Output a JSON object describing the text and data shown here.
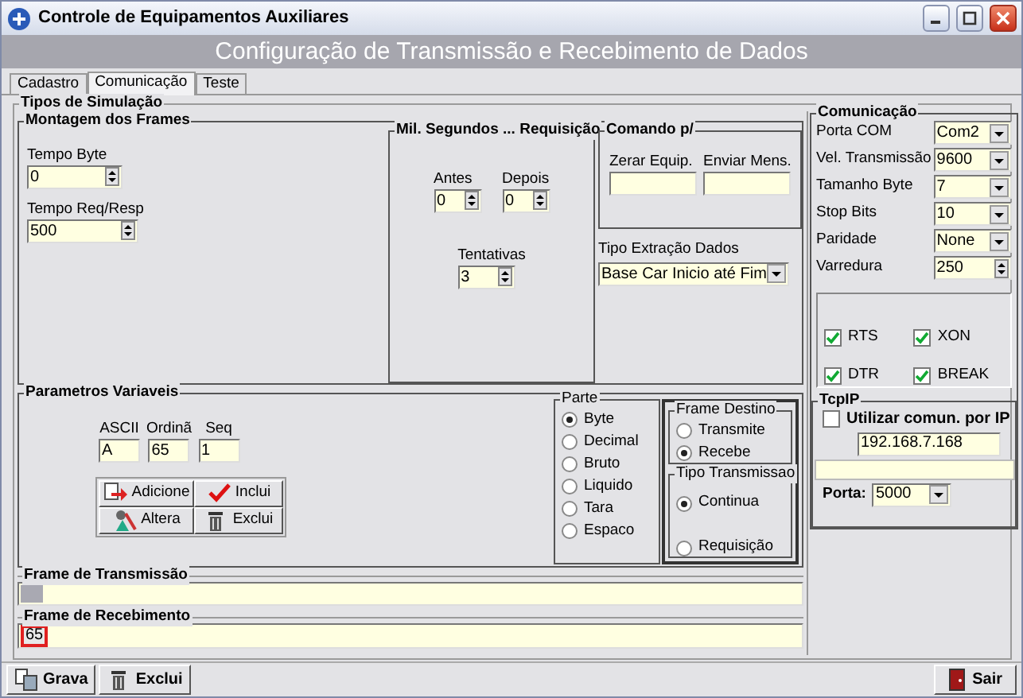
{
  "window": {
    "title": "Controle de Equipamentos Auxiliares"
  },
  "header": "Configuração de Transmissão e Recebimento de Dados",
  "tabs": [
    {
      "label": "Cadastro",
      "selected": false
    },
    {
      "label": "Comunicação",
      "selected": true
    },
    {
      "label": "Teste",
      "selected": false
    }
  ],
  "simulation": {
    "title": "Tipos de Simulação",
    "frame_assembly": {
      "title": "Montagem dos Frames",
      "fields": [
        {
          "label": "Tempo Byte",
          "value": "0"
        },
        {
          "label": "Tempo Req/Resp",
          "value": "500"
        }
      ]
    },
    "request_ms": {
      "title": "Mil. Segundos ... Requisição",
      "fields": [
        {
          "label": "Antes",
          "value": "0"
        },
        {
          "label": "Depois",
          "value": "0"
        },
        {
          "label": "Tentativas",
          "value": "3"
        }
      ]
    },
    "command": {
      "title": "Comando p/",
      "fields": [
        {
          "label": "Zerar Equip."
        },
        {
          "label": "Enviar Mens."
        }
      ]
    },
    "extraction": {
      "label": "Tipo Extração Dados",
      "value": "Base Car Inicio até Fim"
    },
    "variables": {
      "title": "Parametros Variaveis",
      "fields": [
        {
          "label": "ASCII",
          "value": "A"
        },
        {
          "label": "Ordinã",
          "value": "65"
        },
        {
          "label": "Seq",
          "value": "1"
        }
      ],
      "buttons": [
        {
          "label": "Adicione"
        },
        {
          "label": "Inclui"
        },
        {
          "label": "Altera"
        },
        {
          "label": "Exclui"
        }
      ]
    },
    "part": {
      "title": "Parte",
      "options": [
        {
          "label": "Byte",
          "selected": true
        },
        {
          "label": "Decimal",
          "selected": false
        },
        {
          "label": "Bruto",
          "selected": false
        },
        {
          "label": "Liquido",
          "selected": false
        },
        {
          "label": "Tara",
          "selected": false
        },
        {
          "label": "Espaco",
          "selected": false
        }
      ]
    },
    "destination": {
      "title": "Frame Destino",
      "options": [
        {
          "label": "Transmite",
          "selected": false
        },
        {
          "label": "Recebe",
          "selected": true
        }
      ]
    },
    "transmission_type": {
      "title": "Tipo Transmissao",
      "options": [
        {
          "label": "Continua",
          "selected": true
        },
        {
          "label": "Requisição",
          "selected": false
        }
      ]
    },
    "tx_frame": {
      "title": "Frame de Transmissão"
    },
    "rx_frame": {
      "title": "Frame de Recebimento",
      "bytes": [
        "65"
      ]
    }
  },
  "communication": {
    "title": "Comunicação",
    "settings": [
      {
        "label": "Porta COM",
        "value": "Com2",
        "kind": "combo"
      },
      {
        "label": "Vel. Transmissão",
        "value": "9600",
        "kind": "combo"
      },
      {
        "label": "Tamanho Byte",
        "value": "7",
        "kind": "combo"
      },
      {
        "label": "Stop Bits",
        "value": "10",
        "kind": "combo"
      },
      {
        "label": "Paridade",
        "value": "None",
        "kind": "combo"
      },
      {
        "label": "Varredura",
        "value": "250",
        "kind": "spin"
      }
    ],
    "flags": [
      {
        "label": "RTS",
        "checked": true
      },
      {
        "label": "XON",
        "checked": true
      },
      {
        "label": "DTR",
        "checked": true
      },
      {
        "label": "BREAK",
        "checked": true
      }
    ]
  },
  "tcpip": {
    "title": "TcpIP",
    "use_ip": {
      "label": "Utilizar comun. por IP",
      "checked": false
    },
    "ip": "192.168.7.168",
    "port": {
      "label": "Porta:",
      "value": "5000"
    }
  },
  "toolbar": {
    "left": [
      {
        "label": "Grava"
      },
      {
        "label": "Exclui"
      }
    ],
    "right": [
      {
        "label": "Sair"
      }
    ]
  }
}
